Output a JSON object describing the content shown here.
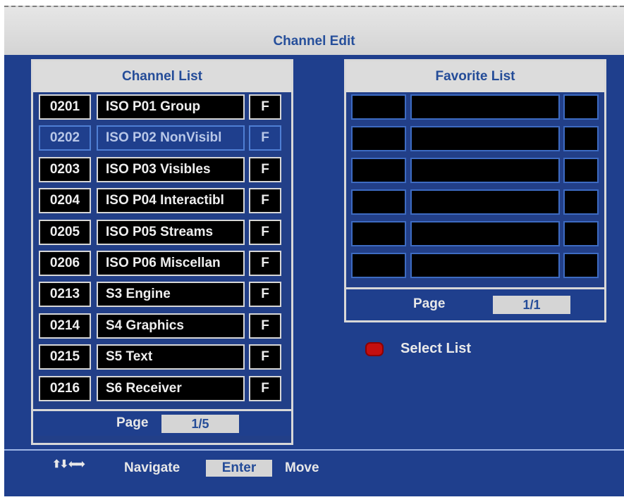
{
  "header": {
    "title": "Channel Edit"
  },
  "channel_list": {
    "title": "Channel List",
    "rows": [
      {
        "num": "0201",
        "name": "ISO P01 Group",
        "flag": "F",
        "selected": false
      },
      {
        "num": "0202",
        "name": "ISO P02 NonVisibl",
        "flag": "F",
        "selected": true
      },
      {
        "num": "0203",
        "name": "ISO P03 Visibles",
        "flag": "F",
        "selected": false
      },
      {
        "num": "0204",
        "name": "ISO P04 Interactibl",
        "flag": "F",
        "selected": false
      },
      {
        "num": "0205",
        "name": "ISO P05 Streams",
        "flag": "F",
        "selected": false
      },
      {
        "num": "0206",
        "name": "ISO P06 Miscellan",
        "flag": "F",
        "selected": false
      },
      {
        "num": "0213",
        "name": "S3 Engine",
        "flag": "F",
        "selected": false
      },
      {
        "num": "0214",
        "name": "S4 Graphics",
        "flag": "F",
        "selected": false
      },
      {
        "num": "0215",
        "name": "S5 Text",
        "flag": "F",
        "selected": false
      },
      {
        "num": "0216",
        "name": "S6 Receiver",
        "flag": "F",
        "selected": false
      }
    ],
    "page_label": "Page",
    "page_value": "1/5"
  },
  "favorite_list": {
    "title": "Favorite List",
    "rows": [
      {},
      {},
      {},
      {},
      {},
      {}
    ],
    "page_label": "Page",
    "page_value": "1/1"
  },
  "legend": {
    "select_list_label": "Select List",
    "color": "#c40f0f"
  },
  "footer": {
    "arrows_glyph": "⬆⬇ ⬅➡",
    "navigate_label": "Navigate",
    "enter_label": "Enter",
    "move_label": "Move"
  }
}
